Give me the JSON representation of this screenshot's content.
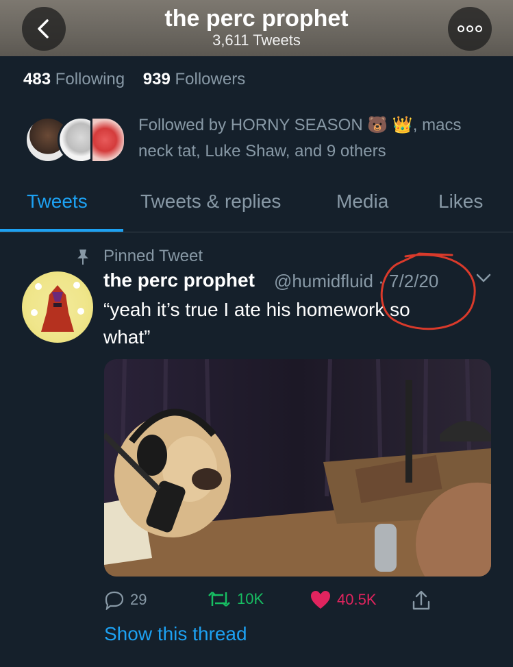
{
  "header": {
    "title": "the perc prophet",
    "subtitle": "3,611 Tweets"
  },
  "stats": {
    "following_count": "483",
    "following_label": "Following",
    "followers_count": "939",
    "followers_label": "Followers"
  },
  "followed_by": {
    "line1": "Followed by HORNY SEASON 🐻 👑, macs",
    "line2": "neck tat, Luke Shaw, and 9 others"
  },
  "tabs": [
    {
      "label": "Tweets",
      "active": true
    },
    {
      "label": "Tweets & replies",
      "active": false
    },
    {
      "label": "Media",
      "active": false
    },
    {
      "label": "Likes",
      "active": false
    }
  ],
  "tweet": {
    "pinned_label": "Pinned Tweet",
    "name": "the perc prophet",
    "handle_date": "@humidfluid · 7/2/20",
    "text_line1": "“yeah it’s true I ate his homework so",
    "text_line2": "what”",
    "replies": "29",
    "retweets": "10K",
    "likes": "40.5K",
    "show_thread": "Show this thread"
  },
  "colors": {
    "background": "#15202b",
    "accent": "#1da1f2",
    "retweet": "#17bf63",
    "like": "#e0245e",
    "annotation": "#d93a2b"
  }
}
